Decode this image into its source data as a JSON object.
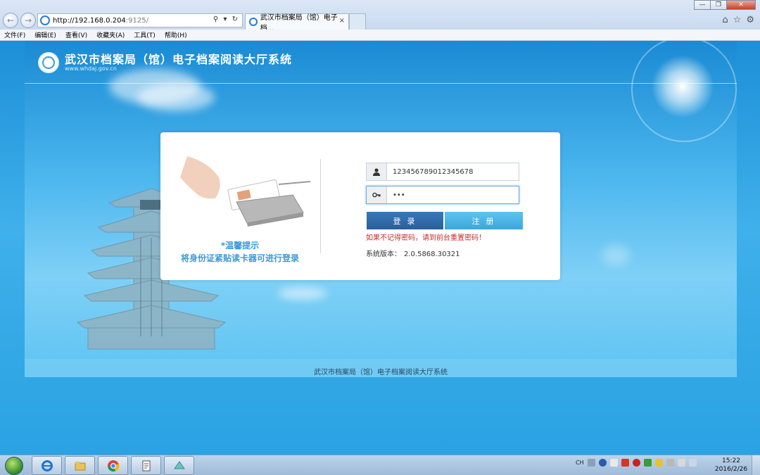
{
  "browser": {
    "address_host": "http://192.168.0.204",
    "address_port": ":9125/",
    "address_tools": "⚲ ▾ ↻",
    "tab_title": "武汉市档案局（馆）电子档...",
    "tab_close": "×",
    "window_controls": {
      "minimize": "—",
      "restore": "❐",
      "close": "✕"
    },
    "right_icons": [
      "home-icon",
      "star-icon",
      "gear-icon"
    ],
    "right_icon_glyphs": [
      "⌂",
      "☆",
      "⚙"
    ],
    "menu": [
      "文件(F)",
      "编辑(E)",
      "查看(V)",
      "收藏夹(A)",
      "工具(T)",
      "帮助(H)"
    ]
  },
  "header": {
    "title": "武汉市档案局（馆）电子档案阅读大厅系统",
    "url": "www.whdaj.gov.cn"
  },
  "login": {
    "hint_title": "*温馨提示",
    "hint_text": "将身份证紧贴读卡器可进行登录",
    "username_value": "123456789012345678",
    "password_value": "•••",
    "login_button": "登 录",
    "register_button": "注 册",
    "warning": "如果不记得密码，请到前台重置密码！",
    "version_label": "系统版本：",
    "version_value": "2.0.5868.30321"
  },
  "footer": {
    "text": "武汉市档案局（馆）电子档案阅读大厅系统"
  },
  "taskbar": {
    "items": [
      "ie-icon",
      "explorer-icon",
      "chrome-icon",
      "document-icon",
      "app-icon"
    ],
    "tray_lang": "CH",
    "clock_time": "15:22",
    "clock_date": "2016/2/26"
  },
  "colors": {
    "primary_button": "#2a5f9b",
    "secondary_button": "#39a7dc",
    "warning_text": "#cc2a2a",
    "hint_text": "#3a9ad8"
  }
}
